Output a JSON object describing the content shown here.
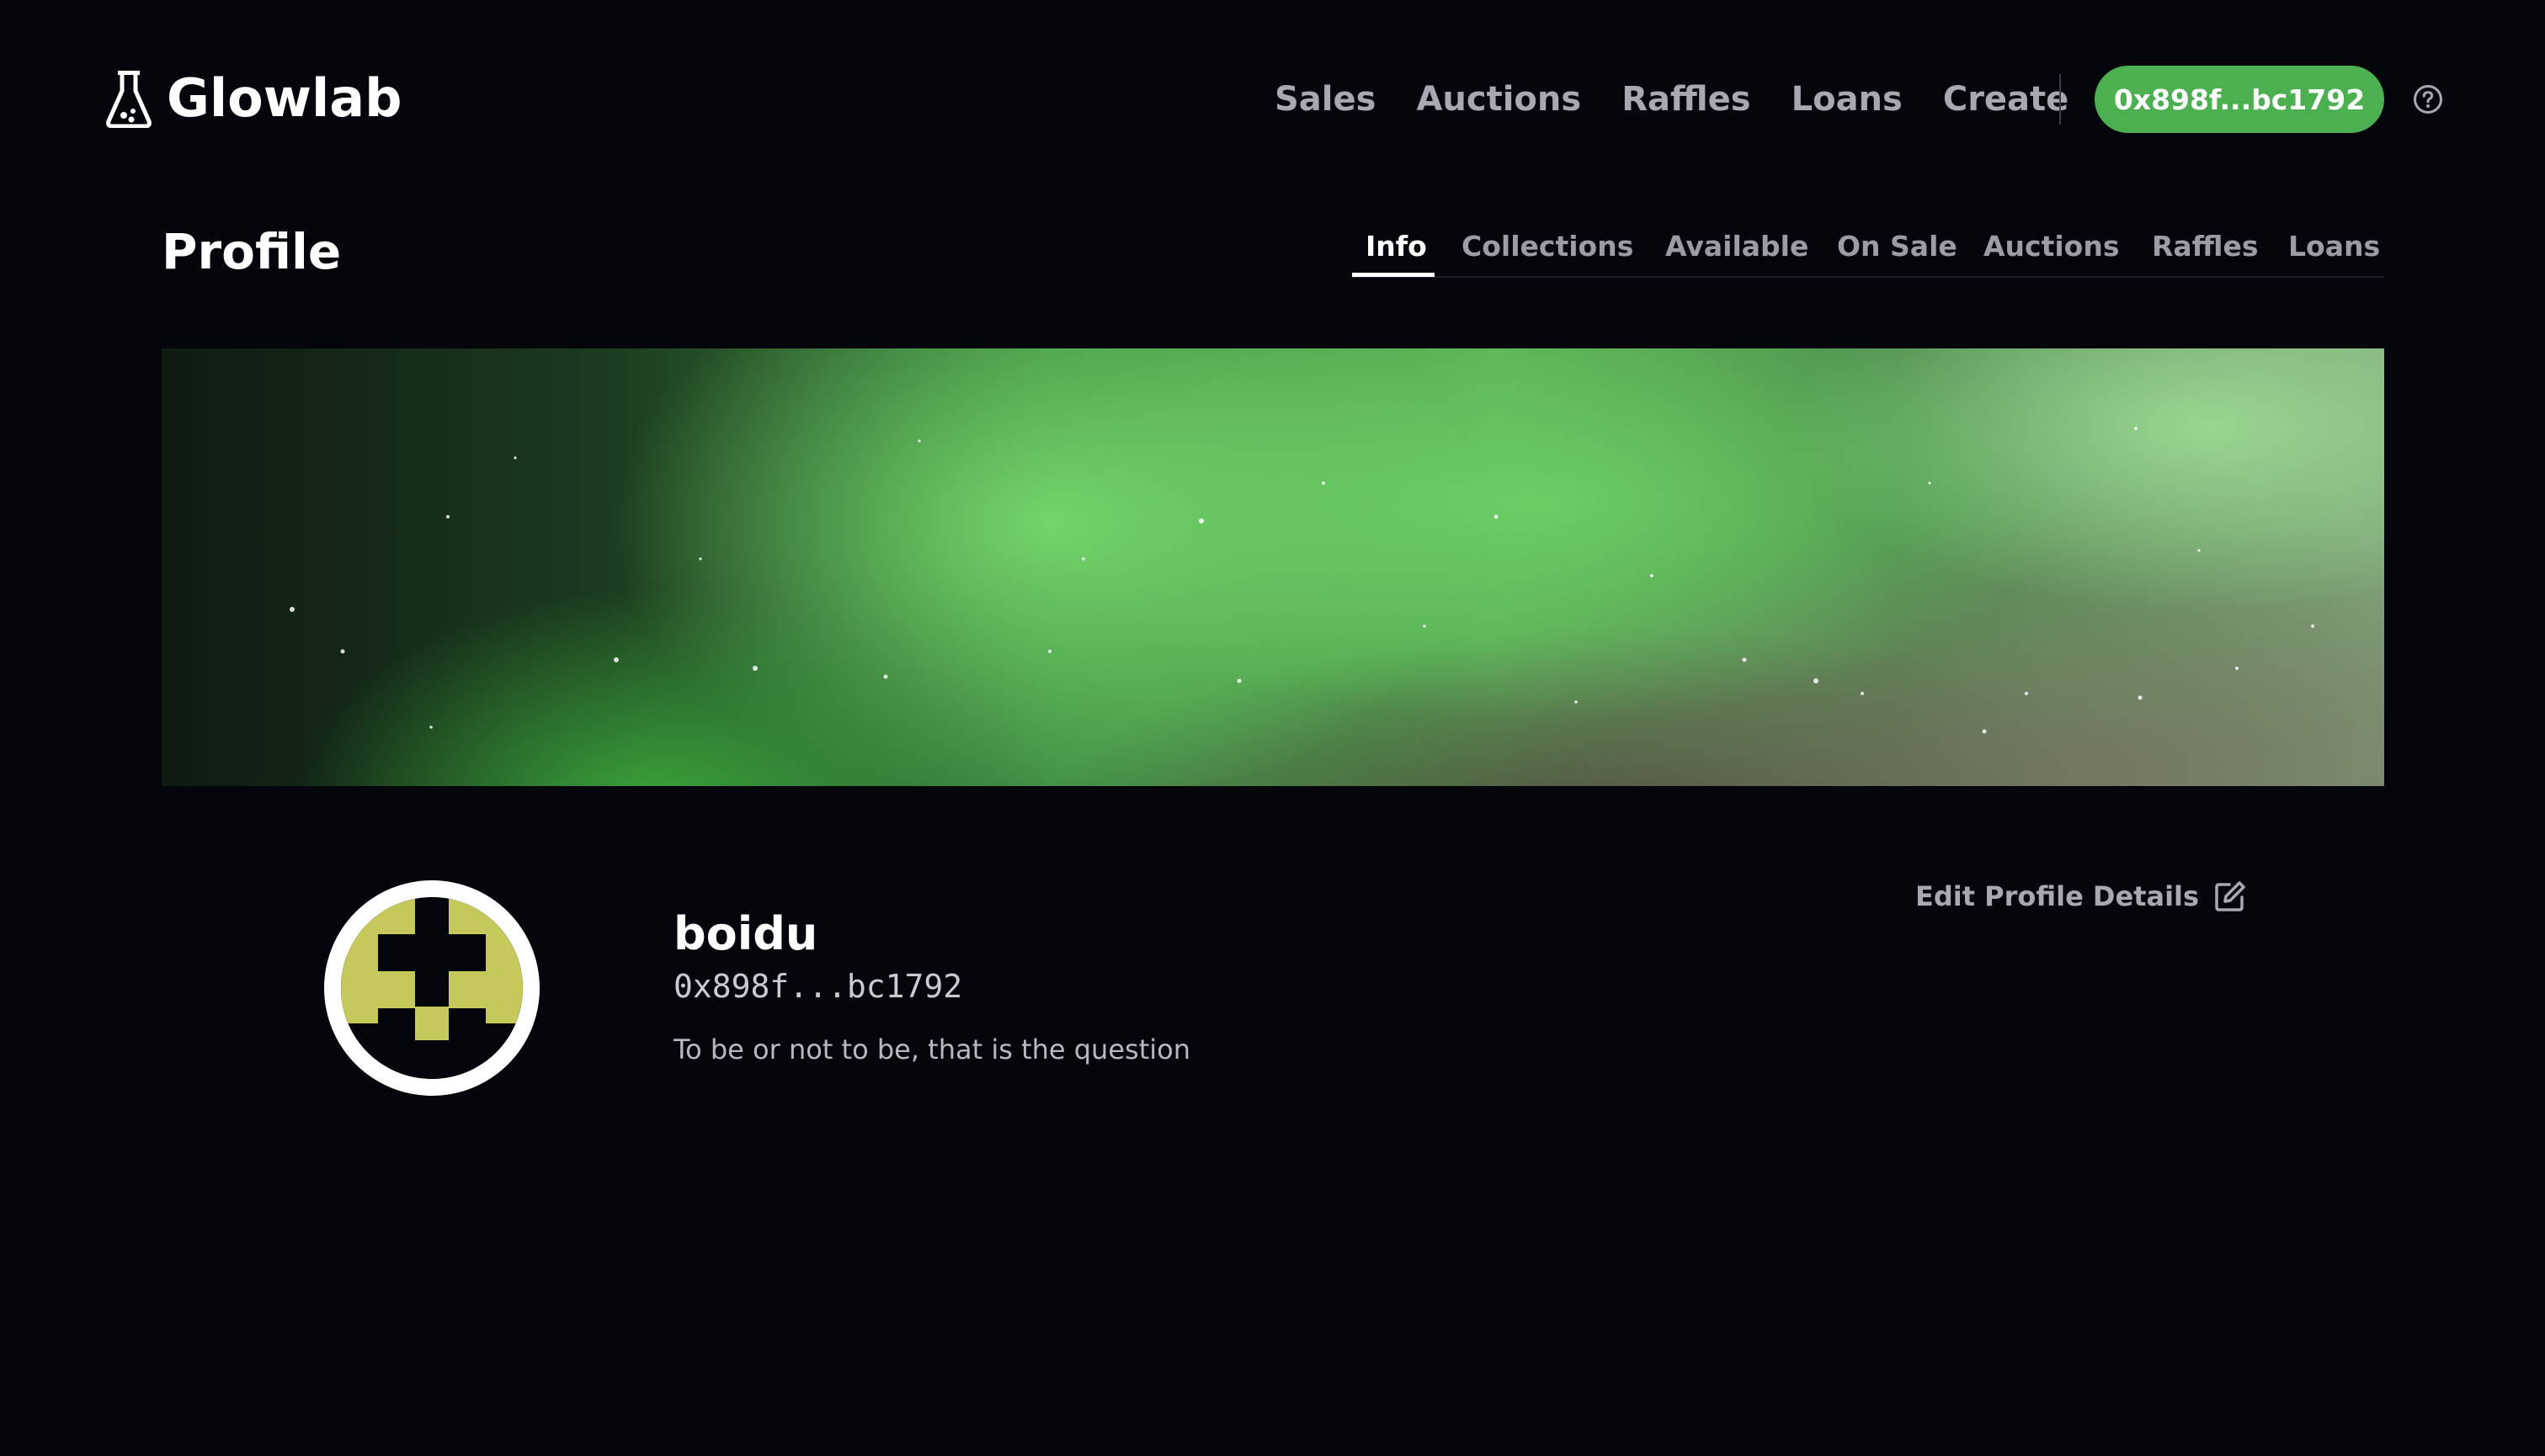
{
  "brand": {
    "name": "Glowlab",
    "icon": "flask-icon"
  },
  "nav": {
    "links": [
      "Sales",
      "Auctions",
      "Raffles",
      "Loans",
      "Create"
    ],
    "wallet_label": "0x898f...bc1792",
    "help_icon": "question-circle-icon"
  },
  "profile": {
    "title": "Profile",
    "tabs": [
      "Info",
      "Collections",
      "Available",
      "On Sale",
      "Auctions",
      "Raffles",
      "Loans"
    ],
    "active_tab": "Info",
    "username": "boidu",
    "address": "0x898f...bc1792",
    "bio": "To be or not to be, that is the question",
    "edit_label": "Edit Profile Details",
    "edit_icon": "edit-square-icon"
  },
  "colors": {
    "background": "#05060b",
    "accent": "#4caf50",
    "avatar_pattern": "#c5c85a",
    "muted_text": "#a6a8b2"
  }
}
